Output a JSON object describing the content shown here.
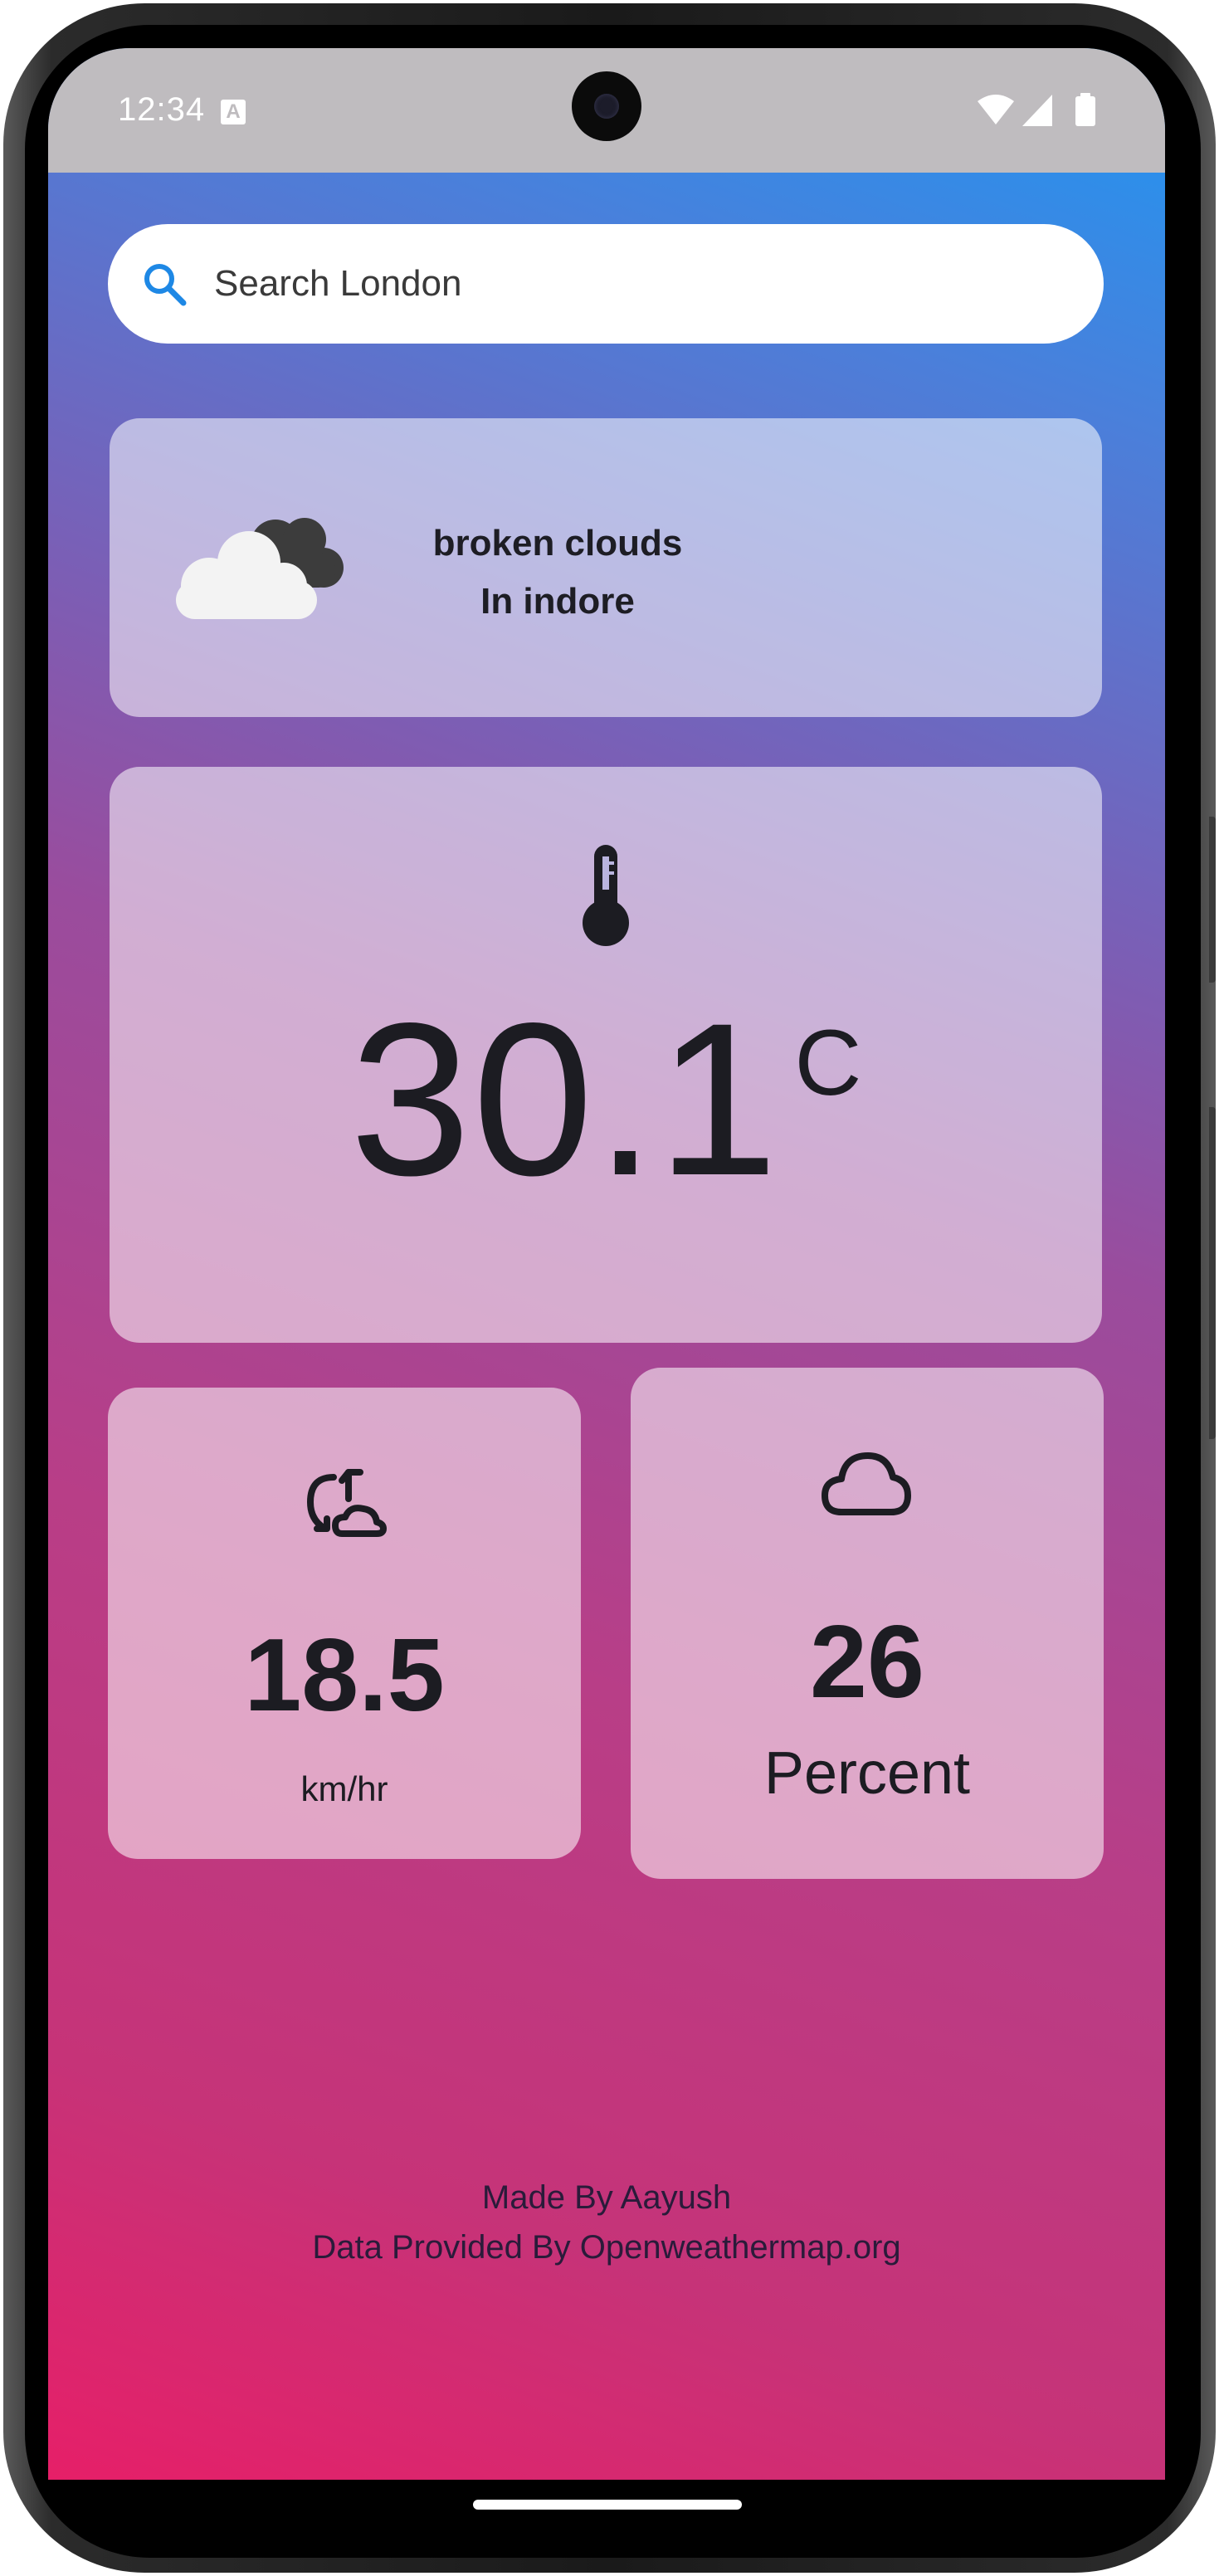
{
  "status_bar": {
    "time": "12:34",
    "notification_glyph": "A",
    "icons": [
      "wifi-icon",
      "cellular-signal-icon",
      "battery-icon"
    ]
  },
  "search": {
    "placeholder": "Search London",
    "icon": "search-icon",
    "icon_color": "#1e88e5"
  },
  "condition": {
    "icon": "broken-clouds-icon",
    "description": "broken clouds",
    "location": "In indore"
  },
  "temperature": {
    "icon": "thermometer-icon",
    "value": "30.1",
    "unit": "C"
  },
  "wind": {
    "icon": "wind-icon",
    "value": "18.5",
    "unit": "km/hr"
  },
  "cloudiness": {
    "icon": "cloud-icon",
    "value": "26",
    "unit": "Percent"
  },
  "footer": {
    "credit": "Made By Aayush",
    "data_source": "Data Provided By Openweathermap.org"
  },
  "colors": {
    "gradient_top": "#1f96f2",
    "gradient_middle": "#9a4c9d",
    "gradient_bottom": "#e61f68",
    "status_bar": "#bfbcbf",
    "card_background": "rgba(255,255,255,0.55)"
  }
}
